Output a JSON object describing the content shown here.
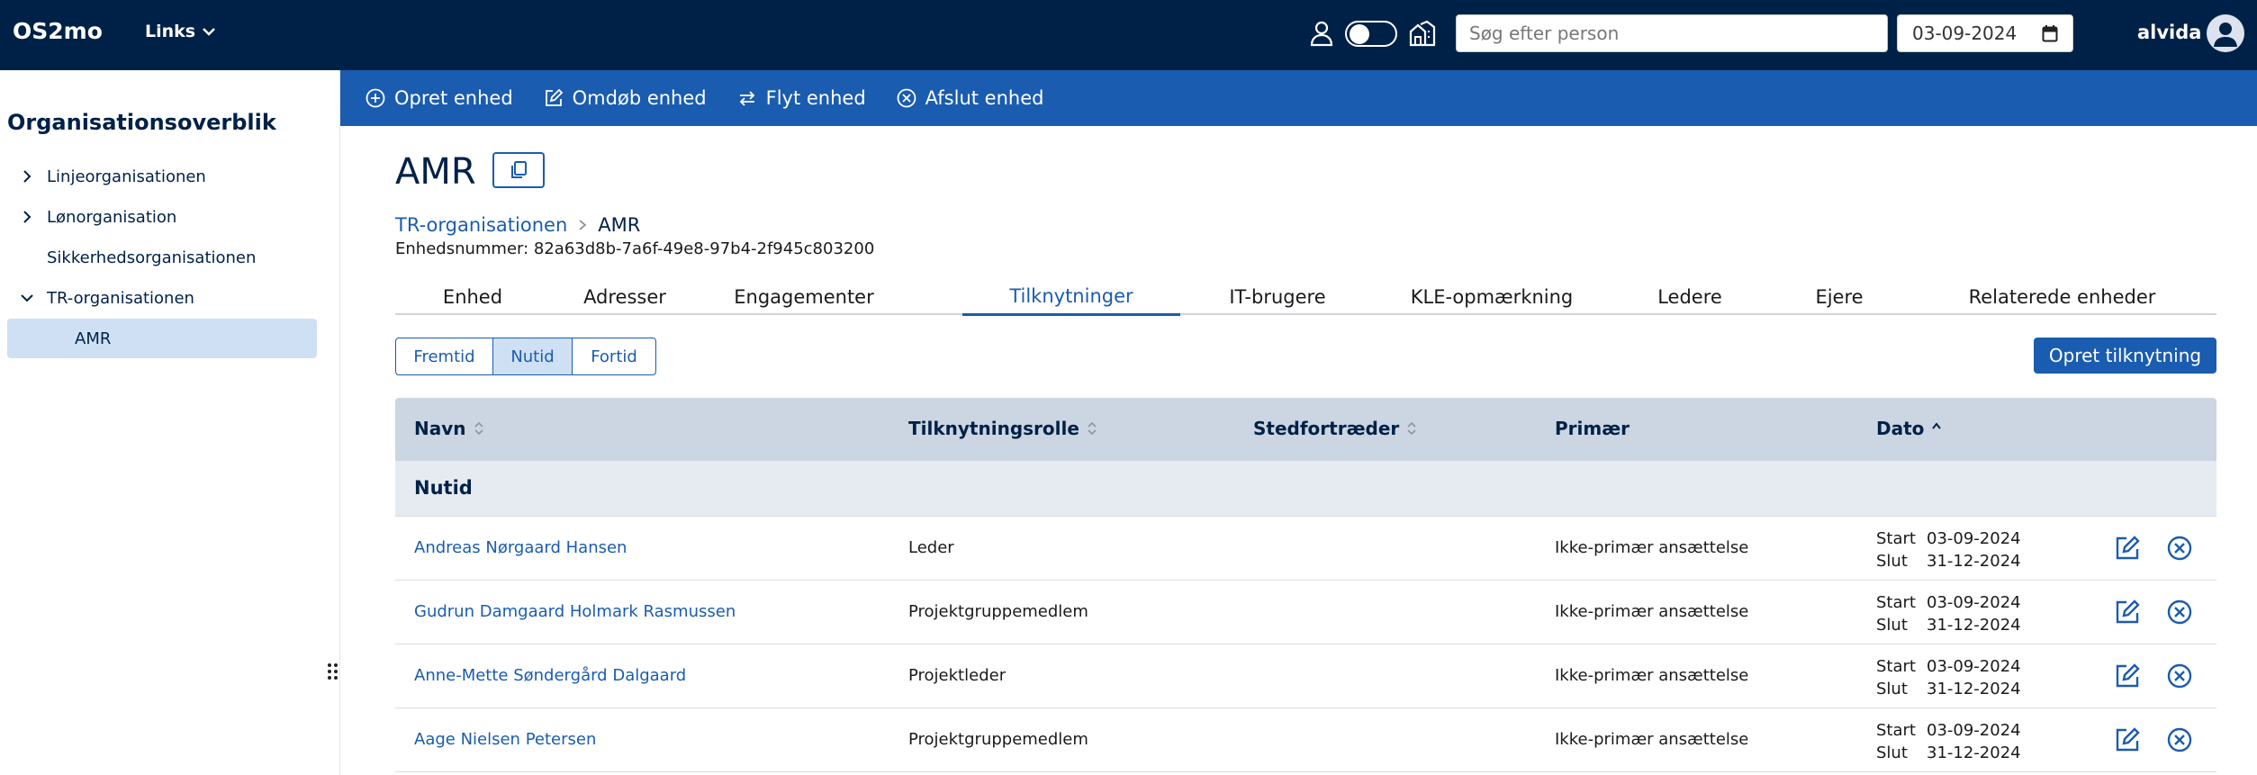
{
  "app": {
    "brand": "OS2mo",
    "links_label": "Links"
  },
  "header": {
    "search_placeholder": "Søg efter person",
    "date_value": "03-09-2024",
    "username": "alvida"
  },
  "sidebar": {
    "title": "Organisationsoverblik",
    "items": [
      {
        "label": "Linjeorganisationen",
        "chevron": "right"
      },
      {
        "label": "Lønorganisation",
        "chevron": "right"
      },
      {
        "label": "Sikkerhedsorganisationen",
        "chevron": ""
      },
      {
        "label": "TR-organisationen",
        "chevron": "down"
      },
      {
        "label": "AMR",
        "chevron": "",
        "selected": true
      }
    ]
  },
  "actions": [
    {
      "label": "Opret enhed",
      "icon": "plus-circle-icon"
    },
    {
      "label": "Omdøb enhed",
      "icon": "edit-icon"
    },
    {
      "label": "Flyt enhed",
      "icon": "swap-arrows-icon"
    },
    {
      "label": "Afslut enhed",
      "icon": "x-circle-icon"
    }
  ],
  "unit": {
    "title": "AMR",
    "breadcrumb": [
      "TR-organisationen",
      "AMR"
    ],
    "unit_number": "Enhedsnummer: 82a63d8b-7a6f-49e8-97b4-2f945c803200"
  },
  "tabs": [
    "Enhed",
    "Adresser",
    "Engagementer",
    "Tilknytninger",
    "IT-brugere",
    "KLE-opmærkning",
    "Ledere",
    "Ejere",
    "Relaterede enheder"
  ],
  "active_tab": "Tilknytninger",
  "time_filter": {
    "options": [
      "Fremtid",
      "Nutid",
      "Fortid"
    ],
    "selected": "Nutid"
  },
  "create_button": "Opret tilknytning",
  "table": {
    "headers": [
      "Navn",
      "Tilknytningsrolle",
      "Stedfortræder",
      "Primær",
      "Dato"
    ],
    "group_label": "Nutid",
    "date_labels": {
      "start": "Start",
      "end": "Slut"
    },
    "rows": [
      {
        "name": "Andreas Nørgaard Hansen",
        "role": "Leder",
        "substitute": "",
        "primary": "Ikke-primær ansættelse",
        "start": "03-09-2024",
        "end": "31-12-2024"
      },
      {
        "name": "Gudrun Damgaard Holmark Rasmussen",
        "role": "Projektgruppemedlem",
        "substitute": "",
        "primary": "Ikke-primær ansættelse",
        "start": "03-09-2024",
        "end": "31-12-2024"
      },
      {
        "name": "Anne-Mette Søndergård Dalgaard",
        "role": "Projektleder",
        "substitute": "",
        "primary": "Ikke-primær ansættelse",
        "start": "03-09-2024",
        "end": "31-12-2024"
      },
      {
        "name": "Aage Nielsen Petersen",
        "role": "Projektgruppemedlem",
        "substitute": "",
        "primary": "Ikke-primær ansættelse",
        "start": "03-09-2024",
        "end": "31-12-2024"
      }
    ]
  },
  "colors": {
    "topbar": "#002147",
    "accent": "#1a5cb0",
    "selected": "#cfe0f5",
    "table_header": "#ccd6e2"
  }
}
